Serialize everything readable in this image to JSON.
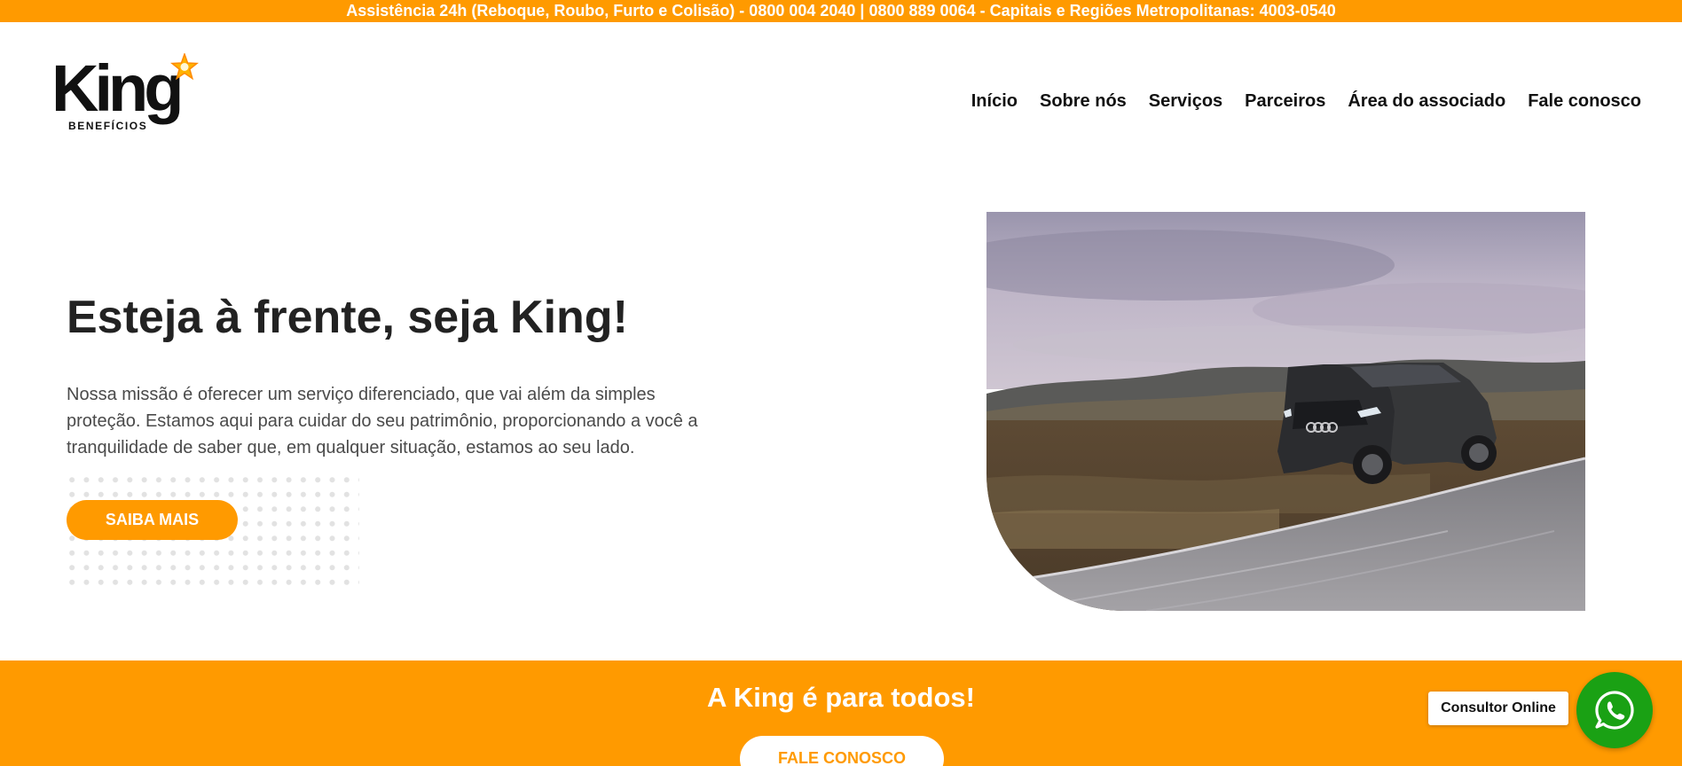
{
  "topbar": {
    "text": "Assistência 24h (Reboque, Roubo, Furto e Colisão) - 0800 004 2040 | 0800 889 0064 - Capitais e Regiões Metropolitanas: 4003-0540"
  },
  "logo": {
    "word": "King",
    "sub": "BENEFÍCIOS"
  },
  "nav": {
    "items": [
      "Início",
      "Sobre nós",
      "Serviços",
      "Parceiros",
      "Área do associado",
      "Fale conosco"
    ]
  },
  "hero": {
    "title": "Esteja à frente, seja King!",
    "text": "Nossa missão é oferecer um serviço diferenciado, que vai além da simples proteção. Estamos aqui para cuidar do seu patrimônio, proporcionando a você a tranquilidade de saber que, em qualquer situação, estamos ao seu lado.",
    "button": "SAIBA MAIS"
  },
  "band": {
    "title": "A King é para todos!",
    "button": "FALE CONOSCO"
  },
  "chat": {
    "label": "Consultor Online"
  },
  "colors": {
    "brand_orange": "#ff9a00",
    "whatsapp_green": "#1aa114"
  },
  "icons": {
    "logo_star": "star-icon",
    "whatsapp": "whatsapp-icon"
  }
}
